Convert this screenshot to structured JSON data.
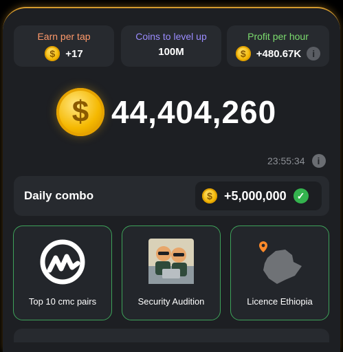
{
  "stats": [
    {
      "label": "Earn per tap",
      "value": "+17",
      "color": "#ff9a6b"
    },
    {
      "label": "Coins to level up",
      "value": "100M",
      "color": "#9b8cff"
    },
    {
      "label": "Profit per hour",
      "value": "+480.67K",
      "color": "#7cdc6e"
    }
  ],
  "balance": "44,404,260",
  "timer": "23:55:34",
  "daily_combo": {
    "label": "Daily combo",
    "reward": "+5,000,000"
  },
  "cards": [
    {
      "caption": "Top 10 cmc pairs"
    },
    {
      "caption": "Security Audition"
    },
    {
      "caption": "Licence Ethiopia"
    }
  ],
  "colors": {
    "accent_gold": "#f2b705",
    "card_border": "#3ea35a",
    "panel": "#1d1f23"
  }
}
